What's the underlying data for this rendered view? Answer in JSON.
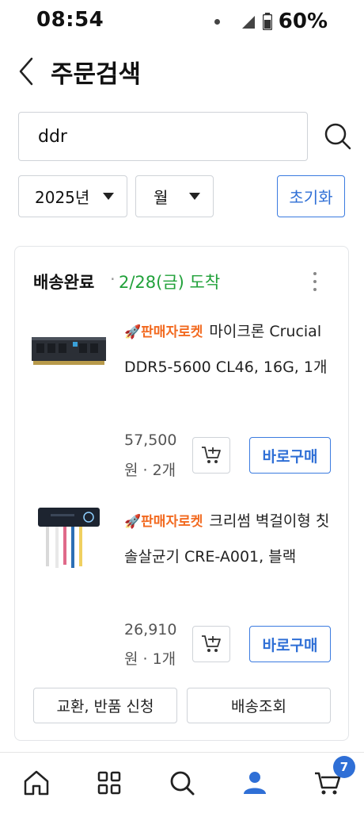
{
  "status_bar": {
    "time": "08:54",
    "battery": "60%"
  },
  "header": {
    "title": "주문검색"
  },
  "search": {
    "value": "ddr"
  },
  "filters": {
    "year": "2025년",
    "month": "월",
    "reset_label": "초기화"
  },
  "order": {
    "status": "배송완료",
    "separator": "·",
    "date": "2/28(금) 도착",
    "items": [
      {
        "badge": "판매자로켓",
        "title": "마이크론 Crucial DDR5-5600 CL46, 16G, 1개",
        "price_line1": "57,500",
        "price_line2": "원 · 2개",
        "buy_label": "바로구매"
      },
      {
        "badge": "판매자로켓",
        "title": "크리썸 벽걸이형 칫솔살균기 CRE-A001, 블랙",
        "price_line1": "26,910",
        "price_line2": "원 · 1개",
        "buy_label": "바로구매"
      }
    ],
    "return_label": "교환, 반품 신청",
    "track_label": "배송조회"
  },
  "bottom_nav": {
    "cart_count": "7"
  },
  "colors": {
    "accent": "#2f6fd6",
    "delivered": "#21a13a",
    "rocket": "#f26a20"
  }
}
